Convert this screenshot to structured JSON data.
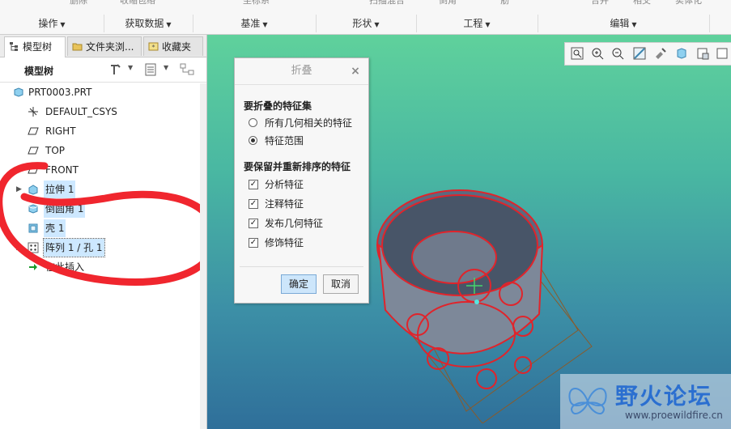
{
  "ribbon": {
    "top_items": [
      "删除",
      "收缩包络",
      "坐标系",
      "扫描混合",
      "倒角",
      "筋",
      "合并",
      "相交",
      "实体化"
    ],
    "groups": [
      {
        "label": "操作"
      },
      {
        "label": "获取数据"
      },
      {
        "label": "基准"
      },
      {
        "label": "形状"
      },
      {
        "label": "工程"
      },
      {
        "label": "编辑"
      }
    ]
  },
  "panel": {
    "tabs": [
      {
        "label": "模型树",
        "icon": "model-tree-icon"
      },
      {
        "label": "文件夹浏...",
        "icon": "folder-icon"
      },
      {
        "label": "收藏夹",
        "icon": "favorites-icon"
      }
    ],
    "header_title": "模型树",
    "tree": [
      {
        "label": "PRT0003.PRT",
        "icon": "part-icon"
      },
      {
        "label": "DEFAULT_CSYS",
        "icon": "csys-icon"
      },
      {
        "label": "RIGHT",
        "icon": "datum-plane-icon"
      },
      {
        "label": "TOP",
        "icon": "datum-plane-icon"
      },
      {
        "label": "FRONT",
        "icon": "datum-plane-icon"
      },
      {
        "label": "拉伸 1",
        "icon": "extrude-icon"
      },
      {
        "label": "倒圆角 1",
        "icon": "round-icon"
      },
      {
        "label": "壳 1",
        "icon": "shell-icon"
      },
      {
        "label": "阵列 1 / 孔 1",
        "icon": "pattern-icon"
      },
      {
        "label": "在此插入",
        "icon": "insert-here-icon"
      }
    ]
  },
  "dialog": {
    "title": "折叠",
    "section1": "要折叠的特征集",
    "radio_options": [
      {
        "label": "所有几何相关的特征",
        "selected": false
      },
      {
        "label": "特征范围",
        "selected": true
      }
    ],
    "section2": "要保留并重新排序的特征",
    "checkbox_options": [
      {
        "label": "分析特征",
        "checked": true
      },
      {
        "label": "注释特征",
        "checked": true
      },
      {
        "label": "发布几何特征",
        "checked": true
      },
      {
        "label": "修饰特征",
        "checked": true
      }
    ],
    "ok_label": "确定",
    "cancel_label": "取消",
    "check_mark": "✓"
  },
  "watermark": {
    "title": "野火论坛",
    "url": "www.proewildfire.cn"
  },
  "colors": {
    "highlight": "#cde8ff",
    "model_edges": "#e0242b"
  }
}
